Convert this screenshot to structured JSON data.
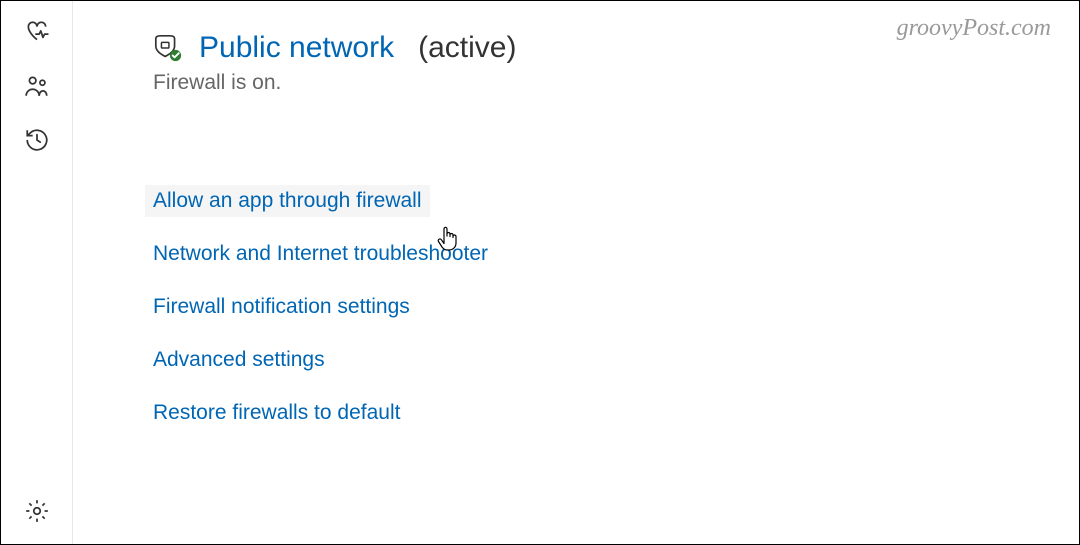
{
  "sidebar": {
    "items": [
      {
        "name": "device-performance-health-icon"
      },
      {
        "name": "family-options-icon"
      },
      {
        "name": "protection-history-icon"
      }
    ],
    "bottom": {
      "name": "settings-icon"
    }
  },
  "header": {
    "icon": "public-network-shield-icon",
    "title": "Public network",
    "status": "(active)"
  },
  "subtitle": "Firewall is on.",
  "links": [
    {
      "label": "Allow an app through firewall"
    },
    {
      "label": "Network and Internet troubleshooter"
    },
    {
      "label": "Firewall notification settings"
    },
    {
      "label": "Advanced settings"
    },
    {
      "label": "Restore firewalls to default"
    }
  ],
  "watermark": "groovyPost.com"
}
